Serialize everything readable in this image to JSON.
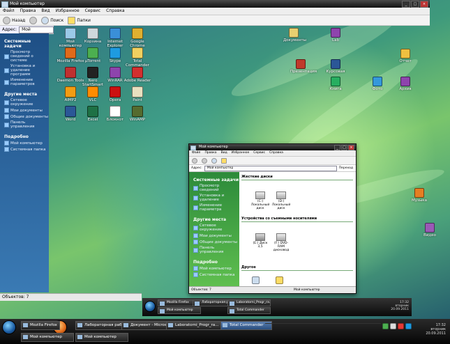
{
  "back_window": {
    "title": "Мой компьютер",
    "menu": [
      "Файл",
      "Правка",
      "Вид",
      "Избранное",
      "Сервис",
      "Справка"
    ],
    "toolbar": {
      "back": "Назад",
      "search": "Поиск",
      "folders": "Папки"
    },
    "address_label": "Адрес:",
    "address_value": "Мой компьютер",
    "sidebar": {
      "sections": [
        {
          "header": "Системные задачи",
          "items": [
            "Просмотр сведений о системе",
            "Установка и удаление программ",
            "Изменение параметров"
          ]
        },
        {
          "header": "Другие места",
          "items": [
            "Сетевое окружение",
            "Мои документы",
            "Общие документы",
            "Панель управления"
          ]
        },
        {
          "header": "Подробно",
          "items": [
            "Мой компьютер",
            "Системная папка"
          ]
        }
      ]
    },
    "status": "Объектов: 7"
  },
  "desktop_icons": [
    {
      "label": "Мой компьютер",
      "color": "#9bc9e8"
    },
    {
      "label": "Корзина",
      "color": "#cfd8dc"
    },
    {
      "label": "Internet Explorer",
      "color": "#3a8fd8"
    },
    {
      "label": "Google Chrome",
      "color": "#e0b030"
    },
    {
      "label": "Mozilla Firefox",
      "color": "#e06a1a"
    },
    {
      "label": "µTorrent",
      "color": "#4caf50"
    },
    {
      "label": "Skype",
      "color": "#1e9be0"
    },
    {
      "label": "Total Commander",
      "color": "#f0d060"
    },
    {
      "label": "Daemon Tools",
      "color": "#c03030"
    },
    {
      "label": "Nero StartSmart",
      "color": "#222222"
    },
    {
      "label": "WinRAR",
      "color": "#8e44ad"
    },
    {
      "label": "Adobe Reader",
      "color": "#d32f2f"
    },
    {
      "label": "AIMP2",
      "color": "#f39c12"
    },
    {
      "label": "VLC",
      "color": "#ff8c00"
    },
    {
      "label": "Opera",
      "color": "#cc1010"
    },
    {
      "label": "Paint",
      "color": "#e8e0c0"
    },
    {
      "label": "Word",
      "color": "#2b5797"
    },
    {
      "label": "Excel",
      "color": "#1e7145"
    },
    {
      "label": "Блокнот",
      "color": "#ffffff"
    },
    {
      "label": "WinAMP",
      "color": "#556b2f"
    }
  ],
  "right_icons": [
    {
      "label": "Документы",
      "color": "#e8d070"
    },
    {
      "label": "Lab",
      "color": "#8e44ad"
    },
    {
      "label": "Презентация",
      "color": "#c0392b"
    },
    {
      "label": "Курсовая",
      "color": "#2b5797"
    },
    {
      "label": "Отчет",
      "color": "#f0c040"
    },
    {
      "label": "Фото",
      "color": "#3498db"
    },
    {
      "label": "Архив",
      "color": "#8e44ad"
    },
    {
      "label": "Книга",
      "color": "#27ae60"
    },
    {
      "label": "Музыка",
      "color": "#e67e22"
    },
    {
      "label": "Видео",
      "color": "#9b59b6"
    }
  ],
  "front_window": {
    "title": "Мой компьютер",
    "menu": [
      "Файл",
      "Правка",
      "Вид",
      "Избранное",
      "Сервис",
      "Справка"
    ],
    "address_label": "Адрес:",
    "address_value": "Мой компьютер",
    "go": "Переход",
    "sidebar": {
      "sections": [
        {
          "header": "Системные задачи",
          "items": [
            "Просмотр сведений",
            "Установка и удаление",
            "Изменение параметра"
          ]
        },
        {
          "header": "Другие места",
          "items": [
            "Сетевое окружение",
            "Мои документы",
            "Общие документы",
            "Панель управления"
          ]
        },
        {
          "header": "Подробно",
          "items": [
            "Мой компьютер",
            "Системная папка"
          ]
        }
      ]
    },
    "sections": [
      "Жесткие диски",
      "Устройства со съемными носителями",
      "Другое"
    ],
    "drives": [
      "(C:) Локальный диск",
      "(D:) Локальный диск",
      "(E:) Диск 3,5",
      "(F:) DVD-RAM дисковод"
    ],
    "status": "Объектов: 7",
    "status_right": "Мой компьютер"
  },
  "taskbar": {
    "tasks": [
      "Mozilla Firefox",
      "Мой компьютер",
      "Лабораторная работа",
      "Laboratorni_Progr_ra...",
      "Документ - Microsoft",
      "Total Commander",
      "Мой компьютер"
    ],
    "clock_time": "17:32",
    "clock_day": "вторник",
    "clock_date": "20.09.2011"
  }
}
